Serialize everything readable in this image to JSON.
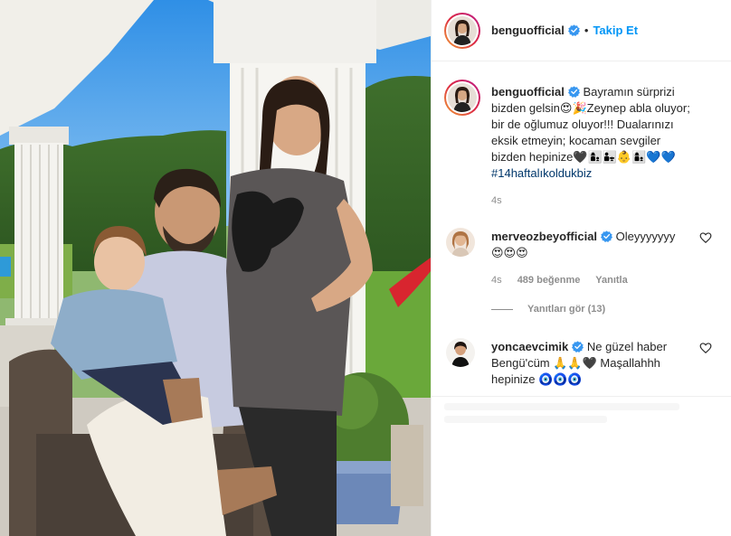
{
  "post": {
    "username": "benguofficial",
    "follow_label": "Takip Et",
    "separator": "•",
    "caption_lines": [
      "Bayramın sürprizi",
      "bizden gelsin😍🎉Zeynep abla oluyor;",
      "bir de oğlumuz oluyor!!! Dualarınızı",
      "eksik etmeyin; kocaman sevgiler",
      "bizden hepinize🖤👩‍👦👨‍👧👶👩‍👦💙💙"
    ],
    "hashtag": "#14haftalıkoldukbiz",
    "caption_time": "4s"
  },
  "comments": [
    {
      "username": "merveozbeyofficial",
      "text_line1": "Oleyyyyyyy",
      "text_line2": "😍😍😍",
      "time": "4s",
      "likes": "489 beğenme",
      "reply_label": "Yanıtla"
    },
    {
      "username": "yoncaevcimik",
      "text_line1": "Ne güzel haber",
      "text_line2": "Bengü'cüm 🙏🙏🖤 Maşallahhh",
      "text_line3": "hepinize 🧿🧿🧿"
    }
  ],
  "view_replies": "Yanıtları gör (13)",
  "colors": {
    "accent": "#0095f6",
    "hashtag": "#00376b",
    "muted": "#8e8e8e",
    "text": "#262626"
  },
  "icons": [
    "verified-badge-icon",
    "heart-icon"
  ]
}
